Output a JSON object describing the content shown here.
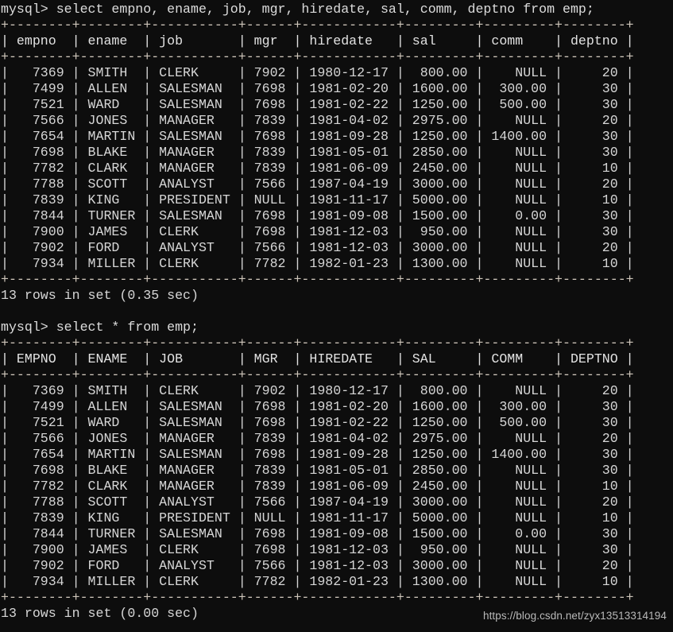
{
  "terminal": {
    "colors": {
      "background": "#0d0d0d",
      "foreground": "#d6d6d6",
      "rule": "#cfc6bb",
      "watermark": "#b9b9b9"
    },
    "blocks": [
      {
        "prompt": "mysql> select empno, ename, job, mgr, hiredate, sal, comm, deptno from emp;",
        "table": {
          "columns": [
            {
              "name": "empno",
              "width": 6,
              "align": "right"
            },
            {
              "name": "ename",
              "width": 6,
              "align": "left"
            },
            {
              "name": "job",
              "width": 9,
              "align": "left"
            },
            {
              "name": "mgr",
              "width": 4,
              "align": "right"
            },
            {
              "name": "hiredate",
              "width": 10,
              "align": "left"
            },
            {
              "name": "sal",
              "width": 7,
              "align": "right"
            },
            {
              "name": "comm",
              "width": 7,
              "align": "right"
            },
            {
              "name": "deptno",
              "width": 6,
              "align": "right"
            }
          ],
          "rows": [
            [
              "7369",
              "SMITH",
              "CLERK",
              "7902",
              "1980-12-17",
              "800.00",
              "NULL",
              "20"
            ],
            [
              "7499",
              "ALLEN",
              "SALESMAN",
              "7698",
              "1981-02-20",
              "1600.00",
              "300.00",
              "30"
            ],
            [
              "7521",
              "WARD",
              "SALESMAN",
              "7698",
              "1981-02-22",
              "1250.00",
              "500.00",
              "30"
            ],
            [
              "7566",
              "JONES",
              "MANAGER",
              "7839",
              "1981-04-02",
              "2975.00",
              "NULL",
              "20"
            ],
            [
              "7654",
              "MARTIN",
              "SALESMAN",
              "7698",
              "1981-09-28",
              "1250.00",
              "1400.00",
              "30"
            ],
            [
              "7698",
              "BLAKE",
              "MANAGER",
              "7839",
              "1981-05-01",
              "2850.00",
              "NULL",
              "30"
            ],
            [
              "7782",
              "CLARK",
              "MANAGER",
              "7839",
              "1981-06-09",
              "2450.00",
              "NULL",
              "10"
            ],
            [
              "7788",
              "SCOTT",
              "ANALYST",
              "7566",
              "1987-04-19",
              "3000.00",
              "NULL",
              "20"
            ],
            [
              "7839",
              "KING",
              "PRESIDENT",
              "NULL",
              "1981-11-17",
              "5000.00",
              "NULL",
              "10"
            ],
            [
              "7844",
              "TURNER",
              "SALESMAN",
              "7698",
              "1981-09-08",
              "1500.00",
              "0.00",
              "30"
            ],
            [
              "7900",
              "JAMES",
              "CLERK",
              "7698",
              "1981-12-03",
              "950.00",
              "NULL",
              "30"
            ],
            [
              "7902",
              "FORD",
              "ANALYST",
              "7566",
              "1981-12-03",
              "3000.00",
              "NULL",
              "20"
            ],
            [
              "7934",
              "MILLER",
              "CLERK",
              "7782",
              "1982-01-23",
              "1300.00",
              "NULL",
              "10"
            ]
          ]
        },
        "status": "13 rows in set (0.35 sec)"
      },
      {
        "prompt": "mysql> select * from emp;",
        "table": {
          "columns": [
            {
              "name": "EMPNO",
              "width": 6,
              "align": "right"
            },
            {
              "name": "ENAME",
              "width": 6,
              "align": "left"
            },
            {
              "name": "JOB",
              "width": 9,
              "align": "left"
            },
            {
              "name": "MGR",
              "width": 4,
              "align": "right"
            },
            {
              "name": "HIREDATE",
              "width": 10,
              "align": "left"
            },
            {
              "name": "SAL",
              "width": 7,
              "align": "right"
            },
            {
              "name": "COMM",
              "width": 7,
              "align": "right"
            },
            {
              "name": "DEPTNO",
              "width": 6,
              "align": "right"
            }
          ],
          "rows": [
            [
              "7369",
              "SMITH",
              "CLERK",
              "7902",
              "1980-12-17",
              "800.00",
              "NULL",
              "20"
            ],
            [
              "7499",
              "ALLEN",
              "SALESMAN",
              "7698",
              "1981-02-20",
              "1600.00",
              "300.00",
              "30"
            ],
            [
              "7521",
              "WARD",
              "SALESMAN",
              "7698",
              "1981-02-22",
              "1250.00",
              "500.00",
              "30"
            ],
            [
              "7566",
              "JONES",
              "MANAGER",
              "7839",
              "1981-04-02",
              "2975.00",
              "NULL",
              "20"
            ],
            [
              "7654",
              "MARTIN",
              "SALESMAN",
              "7698",
              "1981-09-28",
              "1250.00",
              "1400.00",
              "30"
            ],
            [
              "7698",
              "BLAKE",
              "MANAGER",
              "7839",
              "1981-05-01",
              "2850.00",
              "NULL",
              "30"
            ],
            [
              "7782",
              "CLARK",
              "MANAGER",
              "7839",
              "1981-06-09",
              "2450.00",
              "NULL",
              "10"
            ],
            [
              "7788",
              "SCOTT",
              "ANALYST",
              "7566",
              "1987-04-19",
              "3000.00",
              "NULL",
              "20"
            ],
            [
              "7839",
              "KING",
              "PRESIDENT",
              "NULL",
              "1981-11-17",
              "5000.00",
              "NULL",
              "10"
            ],
            [
              "7844",
              "TURNER",
              "SALESMAN",
              "7698",
              "1981-09-08",
              "1500.00",
              "0.00",
              "30"
            ],
            [
              "7900",
              "JAMES",
              "CLERK",
              "7698",
              "1981-12-03",
              "950.00",
              "NULL",
              "30"
            ],
            [
              "7902",
              "FORD",
              "ANALYST",
              "7566",
              "1981-12-03",
              "3000.00",
              "NULL",
              "20"
            ],
            [
              "7934",
              "MILLER",
              "CLERK",
              "7782",
              "1982-01-23",
              "1300.00",
              "NULL",
              "10"
            ]
          ]
        },
        "status": "13 rows in set (0.00 sec)"
      }
    ],
    "watermark": "https://blog.csdn.net/zyx13513314194"
  }
}
